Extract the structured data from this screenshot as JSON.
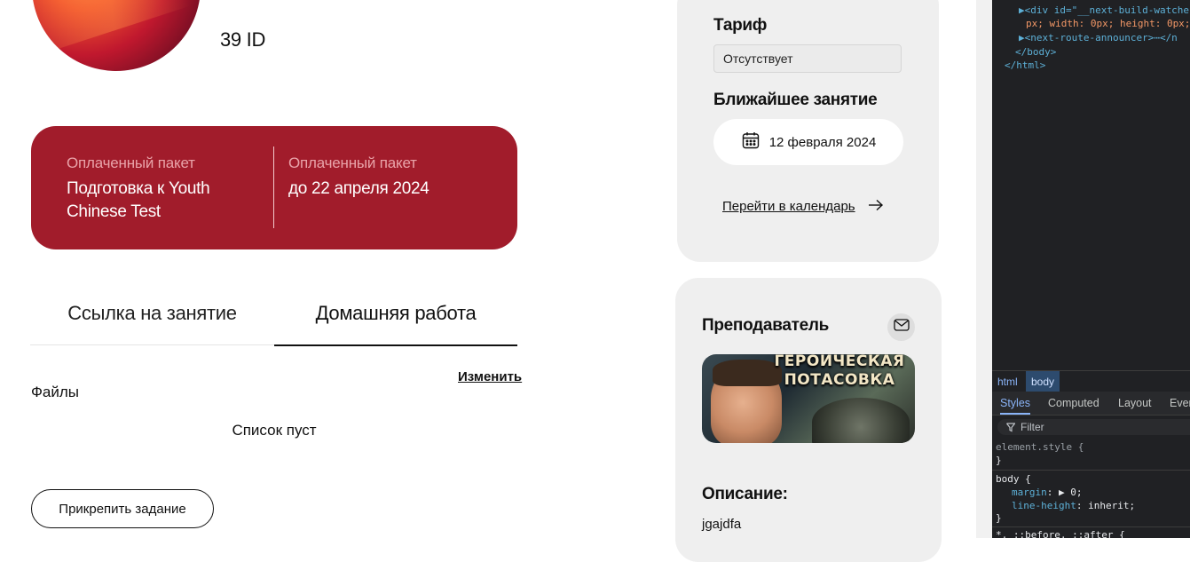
{
  "profile": {
    "id_text": "39 ID"
  },
  "package": {
    "left_label": "Оплаченный пакет",
    "left_value": "Подготовка к Youth Chinese Test",
    "right_label": "Оплаченный пакет",
    "right_value": "до 22 апреля 2024",
    "accent": "#a11c2b"
  },
  "tabs": [
    {
      "label": "Ссылка на занятие",
      "active": false
    },
    {
      "label": "Домашняя работа",
      "active": true
    }
  ],
  "homework": {
    "files_title": "Файлы",
    "edit_label": "Изменить",
    "empty_text": "Список пуст",
    "attach_button": "Прикрепить задание"
  },
  "schedule": {
    "tariff_label": "Тариф",
    "tariff_value": "Отсутствует",
    "next_lesson_label": "Ближайшее занятие",
    "next_lesson_date": "12 февраля 2024",
    "calendar_link": "Перейти в календарь"
  },
  "teacher": {
    "title": "Преподаватель",
    "image_banner_line1": "ГЕРОИЧЕСКАЯ",
    "image_banner_line2": "ПОТАСОВКА",
    "description_label": "Описание:",
    "description_text": "jgajdfa"
  },
  "devtools": {
    "code_lines": [
      "▶<div id=\"__next-build-watche",
      "px; width: 0px; height: 0px;",
      "▶<next-route-announcer>⋯</n",
      "</body>",
      "</html>"
    ],
    "breadcrumbs": [
      "html",
      "body"
    ],
    "tabs": [
      "Styles",
      "Computed",
      "Layout",
      "Even"
    ],
    "filter_placeholder": "Filter",
    "rule1_selector": "element.style {",
    "rule1_close": "}",
    "rule2_selector": "body {",
    "rule2_prop1": "margin",
    "rule2_val1": "▶ 0;",
    "rule2_prop2": "line-height",
    "rule2_val2": "inherit;",
    "rule2_close": "}",
    "rule3_selector": "*, ::before, ::after {"
  }
}
